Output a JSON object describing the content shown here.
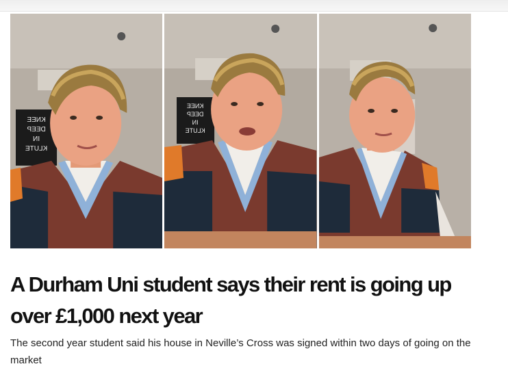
{
  "article": {
    "headline": "A Durham Uni student says their rent is going up over £1,000 next year",
    "subheadline": "The second year student said his house in Neville’s Cross was signed within two days of going on the market"
  },
  "image": {
    "poster_text": "KNEE DEEP IN KLUTE"
  }
}
